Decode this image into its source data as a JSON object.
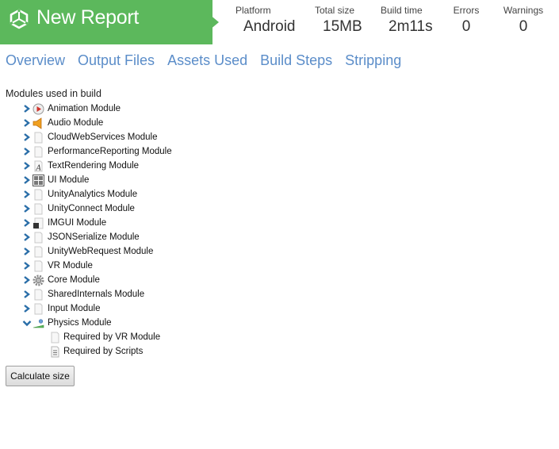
{
  "header": {
    "title": "New Report",
    "stats": [
      {
        "label": "Platform",
        "value": "Android"
      },
      {
        "label": "Total size",
        "value": "15MB"
      },
      {
        "label": "Build time",
        "value": "2m11s"
      },
      {
        "label": "Errors",
        "value": "0"
      },
      {
        "label": "Warnings",
        "value": "0"
      }
    ]
  },
  "tabs": [
    "Overview",
    "Output Files",
    "Assets Used",
    "Build Steps",
    "Stripping"
  ],
  "modules": {
    "heading": "Modules used in build",
    "items": [
      {
        "label": "Animation Module",
        "icon": "animation-icon",
        "expanded": false
      },
      {
        "label": "Audio Module",
        "icon": "audio-icon",
        "expanded": false
      },
      {
        "label": "CloudWebServices Module",
        "icon": "file-icon",
        "expanded": false
      },
      {
        "label": "PerformanceReporting Module",
        "icon": "file-icon",
        "expanded": false
      },
      {
        "label": "TextRendering Module",
        "icon": "text-icon",
        "expanded": false
      },
      {
        "label": "UI Module",
        "icon": "grid-icon",
        "expanded": false
      },
      {
        "label": "UnityAnalytics Module",
        "icon": "file-icon",
        "expanded": false
      },
      {
        "label": "UnityConnect Module",
        "icon": "file-icon",
        "expanded": false
      },
      {
        "label": "IMGUI Module",
        "icon": "imgui-icon",
        "expanded": false
      },
      {
        "label": "JSONSerialize Module",
        "icon": "file-icon",
        "expanded": false
      },
      {
        "label": "UnityWebRequest Module",
        "icon": "file-icon",
        "expanded": false
      },
      {
        "label": "VR Module",
        "icon": "file-icon",
        "expanded": false
      },
      {
        "label": "Core Module",
        "icon": "gear-icon",
        "expanded": false
      },
      {
        "label": "SharedInternals Module",
        "icon": "file-icon",
        "expanded": false
      },
      {
        "label": "Input Module",
        "icon": "file-icon",
        "expanded": false
      },
      {
        "label": "Physics Module",
        "icon": "physics-icon",
        "expanded": true,
        "children": [
          {
            "label": "Required by VR Module",
            "icon": "file-icon"
          },
          {
            "label": "Required by Scripts",
            "icon": "script-icon"
          }
        ]
      }
    ]
  },
  "calculate_button": "Calculate size",
  "colors": {
    "brand": "#5cb85c",
    "tab_link": "#5b8dc9",
    "tree_arrow": "#2a6ea8"
  }
}
